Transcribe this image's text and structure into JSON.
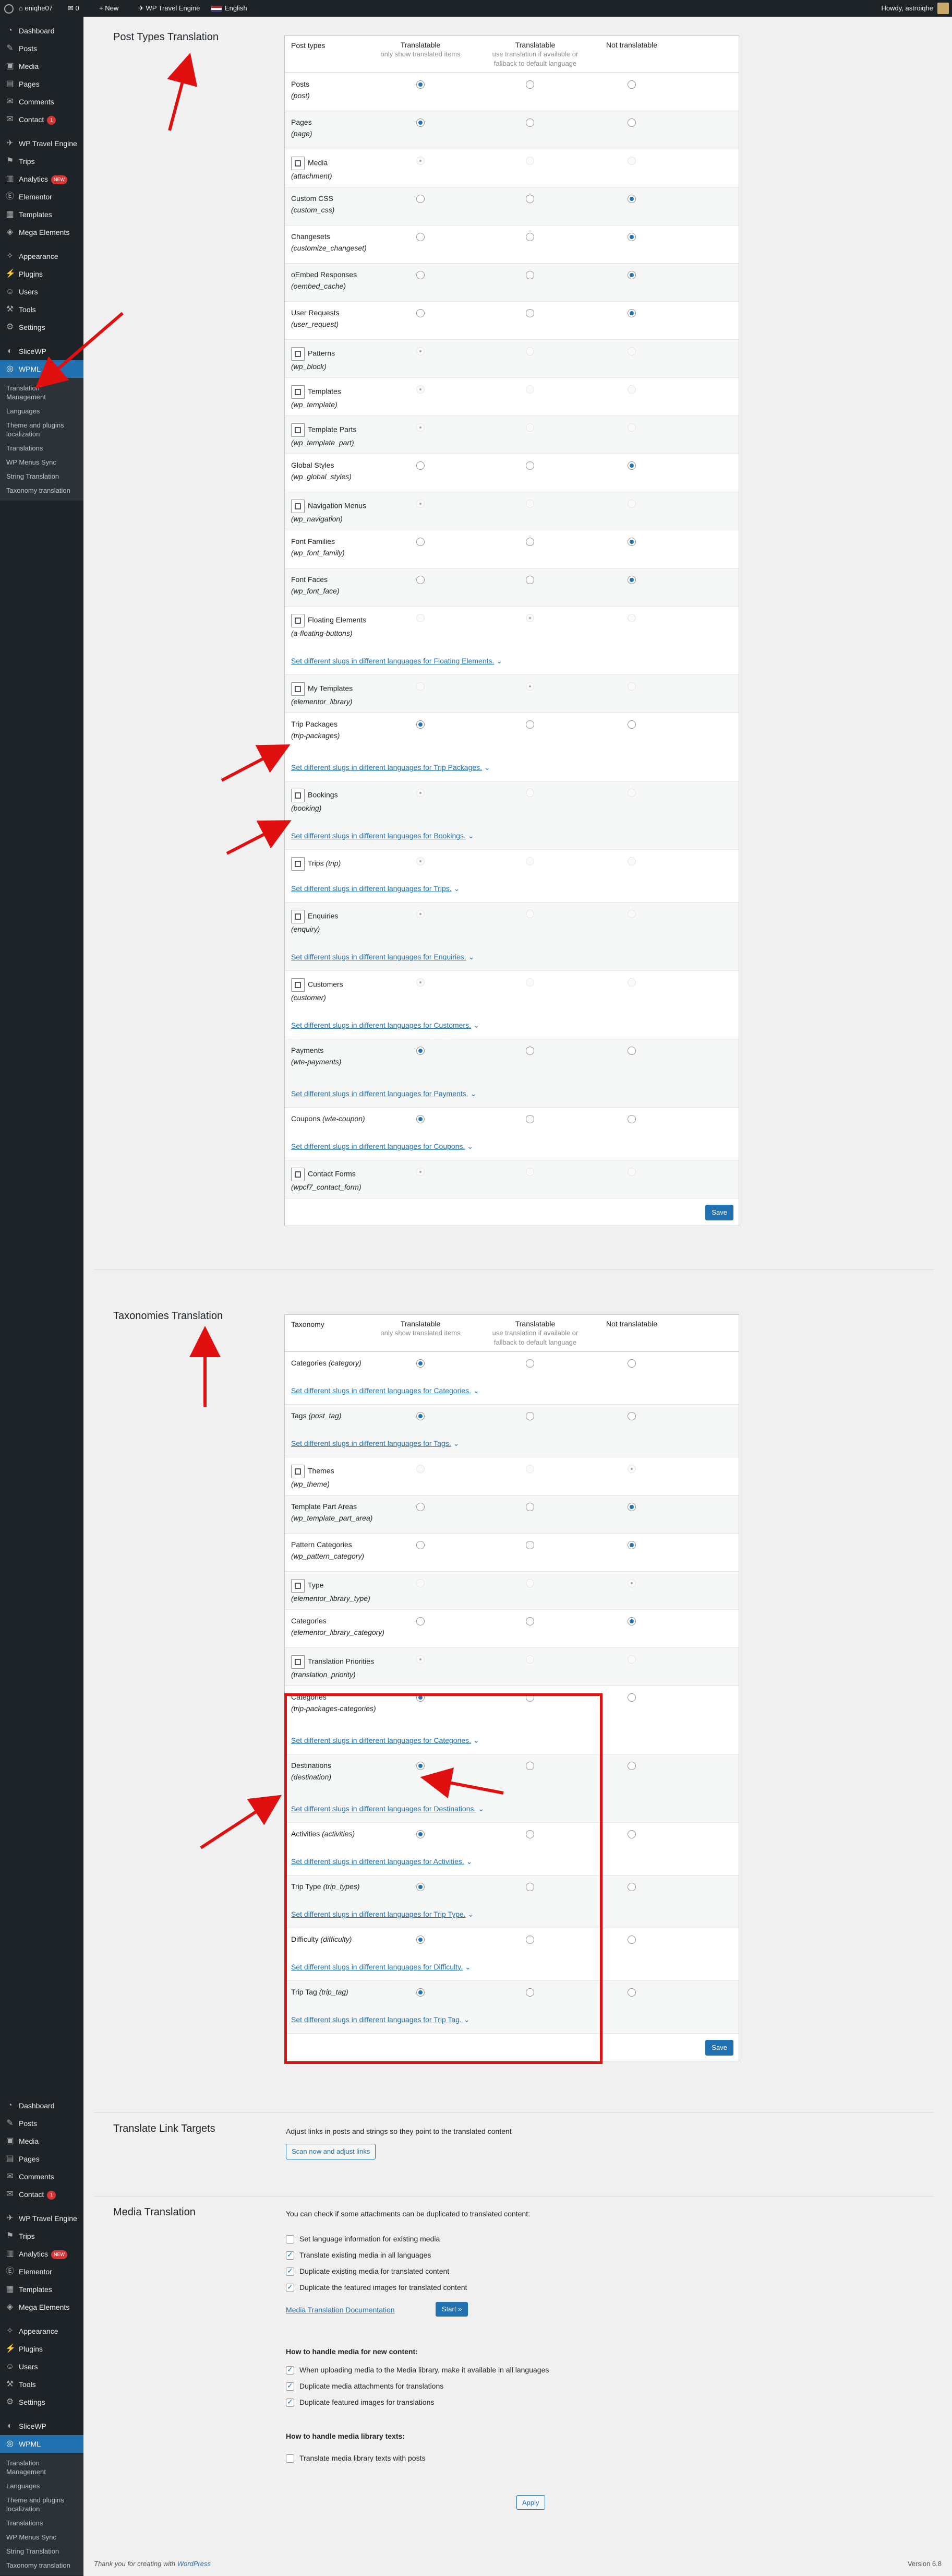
{
  "adminbar": {
    "site_name": "eniqhe07",
    "comments_count": "0",
    "new_label": "New",
    "plugin_label": "WP Travel Engine",
    "language_label": "English",
    "howdy": "Howdy, astroiqhe"
  },
  "sidebar": {
    "items": [
      {
        "label": "Dashboard",
        "icon": "dashboard-icon",
        "glyph": "◔"
      },
      {
        "label": "Posts",
        "icon": "pin-icon",
        "glyph": "✎"
      },
      {
        "label": "Media",
        "icon": "media-icon",
        "glyph": "▣"
      },
      {
        "label": "Pages",
        "icon": "page-icon",
        "glyph": "▤"
      },
      {
        "label": "Comments",
        "icon": "comment-icon",
        "glyph": "✉"
      },
      {
        "label": "Contact",
        "icon": "mail-icon",
        "glyph": "✉",
        "badge": "1"
      },
      {
        "label": "WP Travel Engine",
        "icon": "plane-icon",
        "glyph": "✈"
      },
      {
        "label": "Trips",
        "icon": "map-icon",
        "glyph": "⚑"
      },
      {
        "label": "Analytics",
        "icon": "chart-icon",
        "glyph": "▥",
        "badge": "NEW"
      },
      {
        "label": "Elementor",
        "icon": "elementor-icon",
        "glyph": "Ⓔ"
      },
      {
        "label": "Templates",
        "icon": "folder-icon",
        "glyph": "▦"
      },
      {
        "label": "Mega Elements",
        "icon": "grid-icon",
        "glyph": "◈"
      },
      {
        "label": "Appearance",
        "icon": "brush-icon",
        "glyph": "✧"
      },
      {
        "label": "Plugins",
        "icon": "plug-icon",
        "glyph": "⚡"
      },
      {
        "label": "Users",
        "icon": "user-icon",
        "glyph": "☺"
      },
      {
        "label": "Tools",
        "icon": "wrench-icon",
        "glyph": "⚒"
      },
      {
        "label": "Settings",
        "icon": "settings-icon",
        "glyph": "⚙"
      },
      {
        "label": "SliceWP",
        "icon": "slice-icon",
        "glyph": "◐"
      },
      {
        "label": "WPML",
        "icon": "wpml-icon",
        "glyph": "◎"
      }
    ],
    "submenu": [
      "Translation Management",
      "Languages",
      "Theme and plugins localization",
      "Translations",
      "WP Menus Sync",
      "String Translation",
      "Taxonomy translation"
    ]
  },
  "post_types": {
    "title": "Post Types Translation",
    "headers": {
      "col1": "Post types",
      "col2": "Translatable",
      "col2_sub": "only show translated items",
      "col3": "Translatable",
      "col3_sub": "use translation if available or fallback to default language",
      "col4": "Not translatable"
    },
    "rows": [
      {
        "label": "Posts",
        "slug": "(post)",
        "sel": 0
      },
      {
        "label": "Pages",
        "slug": "(page)",
        "sel": 0
      },
      {
        "label": "Media",
        "slug": "(attachment)",
        "sel": 0,
        "icon": true,
        "dis": true
      },
      {
        "label": "Custom CSS",
        "slug": "(custom_css)",
        "sel": 2
      },
      {
        "label": "Changesets",
        "slug": "(customize_changeset)",
        "sel": 2
      },
      {
        "label": "oEmbed Responses",
        "slug": "(oembed_cache)",
        "sel": 2
      },
      {
        "label": "User Requests",
        "slug": "(user_request)",
        "sel": 2
      },
      {
        "label": "Patterns",
        "slug": "(wp_block)",
        "sel": 0,
        "icon": true,
        "dis": true
      },
      {
        "label": "Templates",
        "slug": "(wp_template)",
        "sel": 0,
        "icon": true,
        "dis": true
      },
      {
        "label": "Template Parts",
        "slug": "(wp_template_part)",
        "sel": 0,
        "icon": true,
        "dis": true
      },
      {
        "label": "Global Styles",
        "slug": "(wp_global_styles)",
        "sel": 2
      },
      {
        "label": "Navigation Menus",
        "slug": "(wp_navigation)",
        "sel": 0,
        "icon": true,
        "dis": true
      },
      {
        "label": "Font Families",
        "slug": "(wp_font_family)",
        "sel": 2
      },
      {
        "label": "Font Faces",
        "slug": "(wp_font_face)",
        "sel": 2
      },
      {
        "label": "Floating Elements",
        "slug": "(a-floating-buttons)",
        "sel": 1,
        "icon": true,
        "dis": true,
        "link": "Set different slugs in different languages for Floating Elements."
      },
      {
        "label": "My Templates",
        "slug": "(elementor_library)",
        "sel": 1,
        "icon": true,
        "dis": true
      },
      {
        "label": "Trip Packages",
        "slug": "(trip-packages)",
        "sel": 0,
        "link": "Set different slugs in different languages for Trip Packages."
      },
      {
        "label": "Bookings",
        "slug": "(booking)",
        "sel": 0,
        "icon": true,
        "dis": true,
        "link": "Set different slugs in different languages for Bookings."
      },
      {
        "label": "Trips",
        "slug": "(trip)",
        "sel": 0,
        "icon": true,
        "dis": true,
        "inline": true,
        "link": "Set different slugs in different languages for Trips."
      },
      {
        "label": "Enquiries",
        "slug": "(enquiry)",
        "sel": 0,
        "icon": true,
        "dis": true,
        "link": "Set different slugs in different languages for Enquiries."
      },
      {
        "label": "Customers",
        "slug": "(customer)",
        "sel": 0,
        "icon": true,
        "dis": true,
        "link": "Set different slugs in different languages for Customers."
      },
      {
        "label": "Payments",
        "slug": "(wte-payments)",
        "sel": 0,
        "link": "Set different slugs in different languages for Payments."
      },
      {
        "label": "Coupons",
        "slug": "(wte-coupon)",
        "sel": 0,
        "inline": true,
        "link": "Set different slugs in different languages for Coupons."
      },
      {
        "label": "Contact Forms",
        "slug": "(wpcf7_contact_form)",
        "sel": 0,
        "icon": true,
        "dis": true
      }
    ],
    "save_label": "Save"
  },
  "taxonomies": {
    "title": "Taxonomies Translation",
    "headers": {
      "col1": "Taxonomy",
      "col2": "Translatable",
      "col2_sub": "only show translated items",
      "col3": "Translatable",
      "col3_sub": "use translation if available or fallback to default language",
      "col4": "Not translatable"
    },
    "rows": [
      {
        "label": "Categories",
        "slug": "(category)",
        "sel": 0,
        "inline": true,
        "link": "Set different slugs in different languages for Categories."
      },
      {
        "label": "Tags",
        "slug": "(post_tag)",
        "sel": 0,
        "inline": true,
        "link": "Set different slugs in different languages for Tags."
      },
      {
        "label": "Themes",
        "slug": "(wp_theme)",
        "sel": 2,
        "icon": true,
        "dis": true
      },
      {
        "label": "Template Part Areas",
        "slug": "(wp_template_part_area)",
        "sel": 2
      },
      {
        "label": "Pattern Categories",
        "slug": "(wp_pattern_category)",
        "sel": 2
      },
      {
        "label": "Type",
        "slug": "(elementor_library_type)",
        "sel": 2,
        "icon": true,
        "dis": true
      },
      {
        "label": "Categories",
        "slug": "(elementor_library_category)",
        "sel": 2
      },
      {
        "label": "Translation Priorities",
        "slug": "(translation_priority)",
        "sel": 0,
        "icon": true,
        "dis": true
      },
      {
        "label": "Categories",
        "slug": "(trip-packages-categories)",
        "sel": 0,
        "link": "Set different slugs in different languages for Categories."
      },
      {
        "label": "Destinations",
        "slug": "(destination)",
        "sel": 0,
        "link": "Set different slugs in different languages for Destinations."
      },
      {
        "label": "Activities",
        "slug": "(activities)",
        "sel": 0,
        "inline": true,
        "link": "Set different slugs in different languages for Activities."
      },
      {
        "label": "Trip Type",
        "slug": "(trip_types)",
        "sel": 0,
        "inline": true,
        "link": "Set different slugs in different languages for Trip Type."
      },
      {
        "label": "Difficulty",
        "slug": "(difficulty)",
        "sel": 0,
        "inline": true,
        "link": "Set different slugs in different languages for Difficulty."
      },
      {
        "label": "Trip Tag",
        "slug": "(trip_tag)",
        "sel": 0,
        "inline": true,
        "link": "Set different slugs in different languages for Trip Tag."
      }
    ],
    "save_label": "Save"
  },
  "link_targets": {
    "title": "Translate Link Targets",
    "desc": "Adjust links in posts and strings so they point to the translated content",
    "button": "Scan now and adjust links"
  },
  "media": {
    "title": "Media Translation",
    "intro": "You can check if some attachments can be duplicated to translated content:",
    "checks": [
      {
        "label": "Set language information for existing media",
        "on": false
      },
      {
        "label": "Translate existing media in all languages",
        "on": true
      },
      {
        "label": "Duplicate existing media for translated content",
        "on": true
      },
      {
        "label": "Duplicate the featured images for translated content",
        "on": true
      }
    ],
    "doc_link": "Media Translation Documentation",
    "start": "Start »",
    "new_heading": "How to handle media for new content:",
    "new_checks": [
      {
        "label": "When uploading media to the Media library, make it available in all languages",
        "on": true
      },
      {
        "label": "Duplicate media attachments for translations",
        "on": true
      },
      {
        "label": "Duplicate featured images for translations",
        "on": true
      }
    ],
    "lib_heading": "How to handle media library texts:",
    "lib_checks": [
      {
        "label": "Translate media library texts with posts",
        "on": false
      }
    ],
    "apply": "Apply"
  },
  "footer": {
    "thanks": "Thank you for creating with ",
    "wp": "WordPress",
    "version": "Version 6.8"
  }
}
